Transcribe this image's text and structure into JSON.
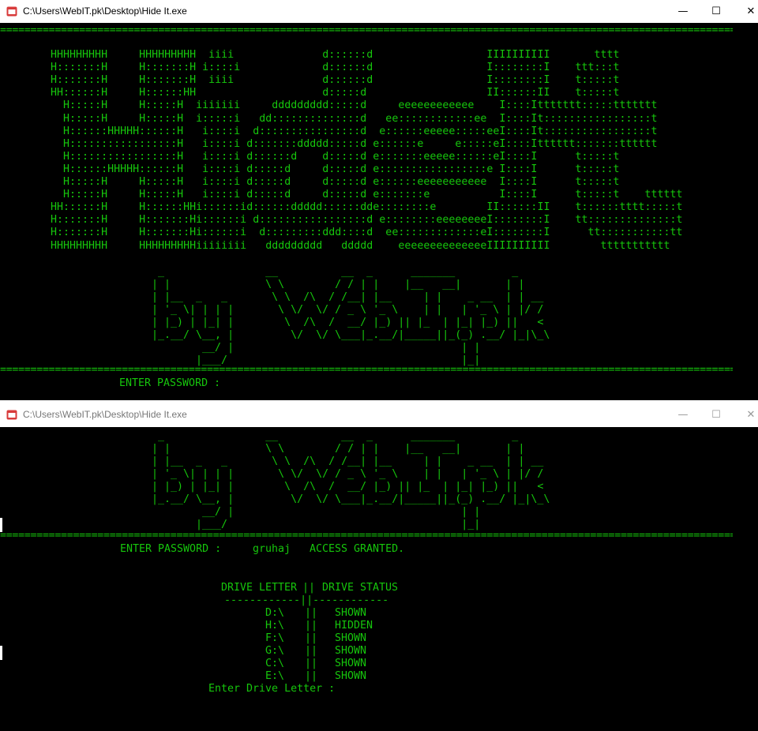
{
  "windows": [
    {
      "title": "C:\\Users\\WebIT.pk\\Desktop\\Hide It.exe",
      "controls": {
        "minimize": "—",
        "maximize": "☐",
        "close": "✕"
      }
    },
    {
      "title": "C:\\Users\\WebIT.pk\\Desktop\\Hide It.exe",
      "controls": {
        "minimize": "—",
        "maximize": "☐",
        "close": "✕"
      }
    }
  ],
  "colors": {
    "console_text": "#16c60c",
    "console_bg": "#000000",
    "icon_red": "#d83b3b"
  },
  "icons": {
    "app": "console-app-icon"
  },
  "separator": "================================================================================================================================================================",
  "hideit_art": [
    "    HHHHHHHHH     HHHHHHHHH  iiii              d::::::d                  IIIIIIIIII       tttt",
    "    H:::::::H     H:::::::H i::::i             d::::::d                  I::::::::I    ttt:::t",
    "    H:::::::H     H:::::::H  iiii              d::::::d                  I::::::::I    t:::::t",
    "    HH::::::H     H::::::HH                    d:::::d                   II::::::II    t:::::t",
    "      H:::::H     H:::::H  iiiiiii     ddddddddd:::::d     eeeeeeeeeeee    I::::Ittttttt:::::ttttttt",
    "      H:::::H     H:::::H  i:::::i   dd::::::::::::::d   ee::::::::::::ee  I::::It:::::::::::::::::t",
    "      H::::::HHHHH::::::H   i::::i  d::::::::::::::::d  e::::::eeeee:::::eeI::::It:::::::::::::::::t",
    "      H:::::::::::::::::H   i::::i d:::::::ddddd:::::d e::::::e     e:::::eI::::Itttttt:::::::tttttt",
    "      H:::::::::::::::::H   i::::i d::::::d    d:::::d e:::::::eeeee::::::eI::::I      t:::::t",
    "      H::::::HHHHH::::::H   i::::i d:::::d     d:::::d e:::::::::::::::::e I::::I      t:::::t",
    "      H:::::H     H:::::H   i::::i d:::::d     d:::::d e::::::eeeeeeeeeee  I::::I      t:::::t",
    "      H:::::H     H:::::H   i::::i d:::::d     d:::::d e:::::::e           I::::I      t:::::t    tttttt",
    "    HH::::::H     H::::::HHi::::::id::::::ddddd::::::dde::::::::e        II::::::II    t::::::tttt:::::t",
    "    H:::::::H     H:::::::Hi::::::i d:::::::::::::::::d e::::::::eeeeeeeeI::::::::I    tt::::::::::::::t",
    "    H:::::::H     H:::::::Hi::::::i  d:::::::::ddd::::d  ee:::::::::::::eI::::::::I      tt:::::::::::tt",
    "    HHHHHHHHH     HHHHHHHHHiiiiiiii   ddddddddd   ddddd    eeeeeeeeeeeeeeIIIIIIIIII        ttttttttttt"
  ],
  "byline_art": [
    " _                __          __  _      _______         _",
    "| |               \\ \\        / / | |    |__   __|       | |",
    "| |__  _   _       \\ \\  /\\  / /__| |__     | |    _ __  | | __",
    "| '_ \\| | | |       \\ \\/  \\/ / _ \\ '_ \\    | |   | '_ \\ | |/ /",
    "| |_) | |_| |        \\  /\\  /  __/ |_) || |_  | |_| |_) ||   <",
    "|_.__/ \\__, |         \\/  \\/ \\___|_.__/|_____||_(_) .__/ |_|\\_\\",
    "        __/ |                                    | |",
    "       |___/                                     |_|"
  ],
  "prompts": {
    "password_label": "ENTER PASSWORD :",
    "password_value": "gruhaj",
    "access_message": "ACCESS GRANTED.",
    "drive_prompt": "Enter Drive Letter :"
  },
  "drive_table": {
    "headers": [
      "DRIVE LETTER",
      "DRIVE STATUS"
    ],
    "column_divider": "||",
    "rule": "------------||------------",
    "rows": [
      {
        "letter": "D:\\",
        "status": "SHOWN"
      },
      {
        "letter": "H:\\",
        "status": "HIDDEN"
      },
      {
        "letter": "F:\\",
        "status": "SHOWN"
      },
      {
        "letter": "G:\\",
        "status": "SHOWN"
      },
      {
        "letter": "C:\\",
        "status": "SHOWN"
      },
      {
        "letter": "E:\\",
        "status": "SHOWN"
      }
    ]
  }
}
